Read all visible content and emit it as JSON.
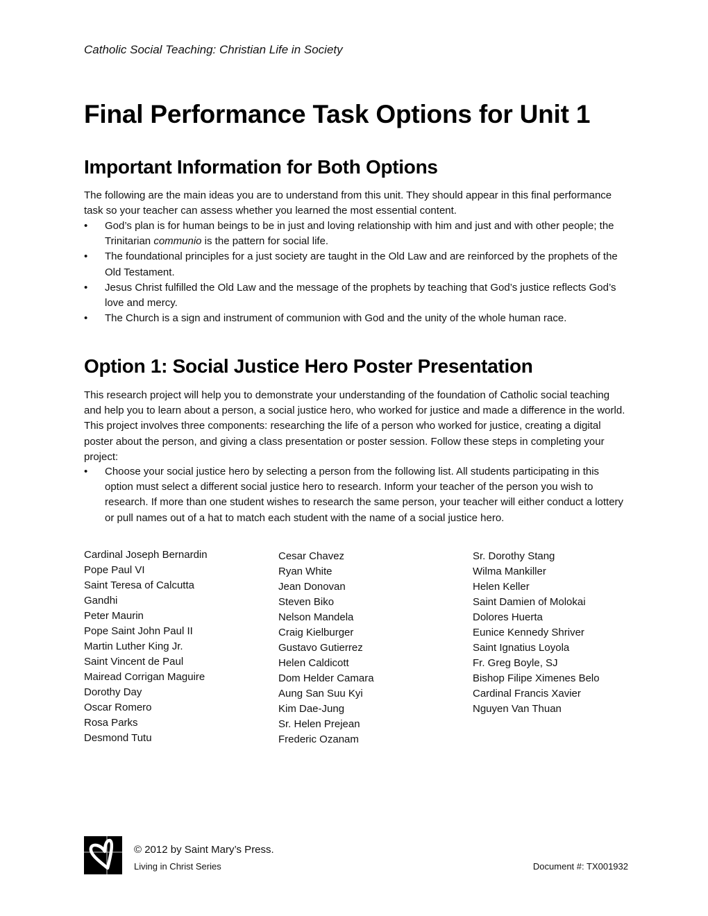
{
  "header": {
    "running_head": "Catholic Social Teaching: Christian Life in Society"
  },
  "title": "Final Performance Task Options for Unit 1",
  "important": {
    "heading": "Important Information for Both Options",
    "intro": "The following are the main ideas you are to understand from this unit. They should appear in this final performance task so your teacher can assess whether you learned the most essential content.",
    "bullet_glyph": "•",
    "bullets": [
      {
        "before": "God’s plan is for human beings to be in just and loving relationship with him and just and with other people; the Trinitarian ",
        "emphasis": "communio",
        "after": " is the pattern for social life."
      },
      {
        "text": "The foundational principles for a just society are taught in the Old Law and are reinforced by the prophets of the Old Testament."
      },
      {
        "text": "Jesus Christ fulfilled the Old Law and the message of the prophets by teaching that God’s justice reflects God’s love and mercy."
      },
      {
        "text": "The Church is a sign and instrument of communion with God and the unity of the whole human race."
      }
    ]
  },
  "option1": {
    "heading": "Option 1: Social Justice Hero Poster Presentation",
    "intro": "This research project will help you to demonstrate your understanding of the foundation of Catholic social teaching and help you to learn about a person, a social justice hero, who worked for justice and made a difference in the world. This project involves three components: researching the life of a person who worked for justice, creating a digital poster about the person, and giving a class presentation or poster session. Follow these steps in completing your project:",
    "bullets": [
      "Choose your social justice hero by selecting a person from the following list. All students participating in this option must select a different social justice hero to research. Inform your teacher of the person you wish to research. If more than one student wishes to research the same person, your teacher will either conduct a lottery or pull names out of a hat to match each student with the name of a social justice hero."
    ],
    "names": {
      "col1": [
        "Cardinal Joseph Bernardin",
        "Pope Paul VI",
        "Saint Teresa of Calcutta",
        "Gandhi",
        "Peter Maurin",
        "Pope Saint John Paul II",
        "Martin Luther King Jr.",
        "Saint Vincent de Paul",
        "Mairead Corrigan Maguire",
        "Dorothy Day",
        "Oscar Romero",
        "Rosa Parks",
        "Desmond Tutu"
      ],
      "col2": [
        "Cesar Chavez",
        "Ryan White",
        "Jean Donovan",
        "Steven Biko",
        "Nelson Mandela",
        "Craig Kielburger",
        "Gustavo Gutierrez",
        "Helen Caldicott",
        "Dom Helder Camara",
        "Aung San Suu Kyi",
        "Kim Dae-Jung",
        "Sr. Helen Prejean",
        "Frederic Ozanam"
      ],
      "col3": [
        "Sr. Dorothy Stang",
        "Wilma Mankiller",
        "Helen Keller",
        "Saint Damien of Molokai",
        "Dolores Huerta",
        "Eunice Kennedy Shriver",
        "Saint Ignatius Loyola",
        "Fr. Greg Boyle, SJ",
        "Bishop Filipe Ximenes Belo",
        "Cardinal Francis Xavier",
        "Nguyen Van Thuan"
      ]
    }
  },
  "footer": {
    "logo_icon": "heart-cross-logo",
    "copyright": "© 2012 by Saint Mary’s Press.",
    "series": "Living in Christ Series",
    "document_number": "Document #: TX001932"
  }
}
